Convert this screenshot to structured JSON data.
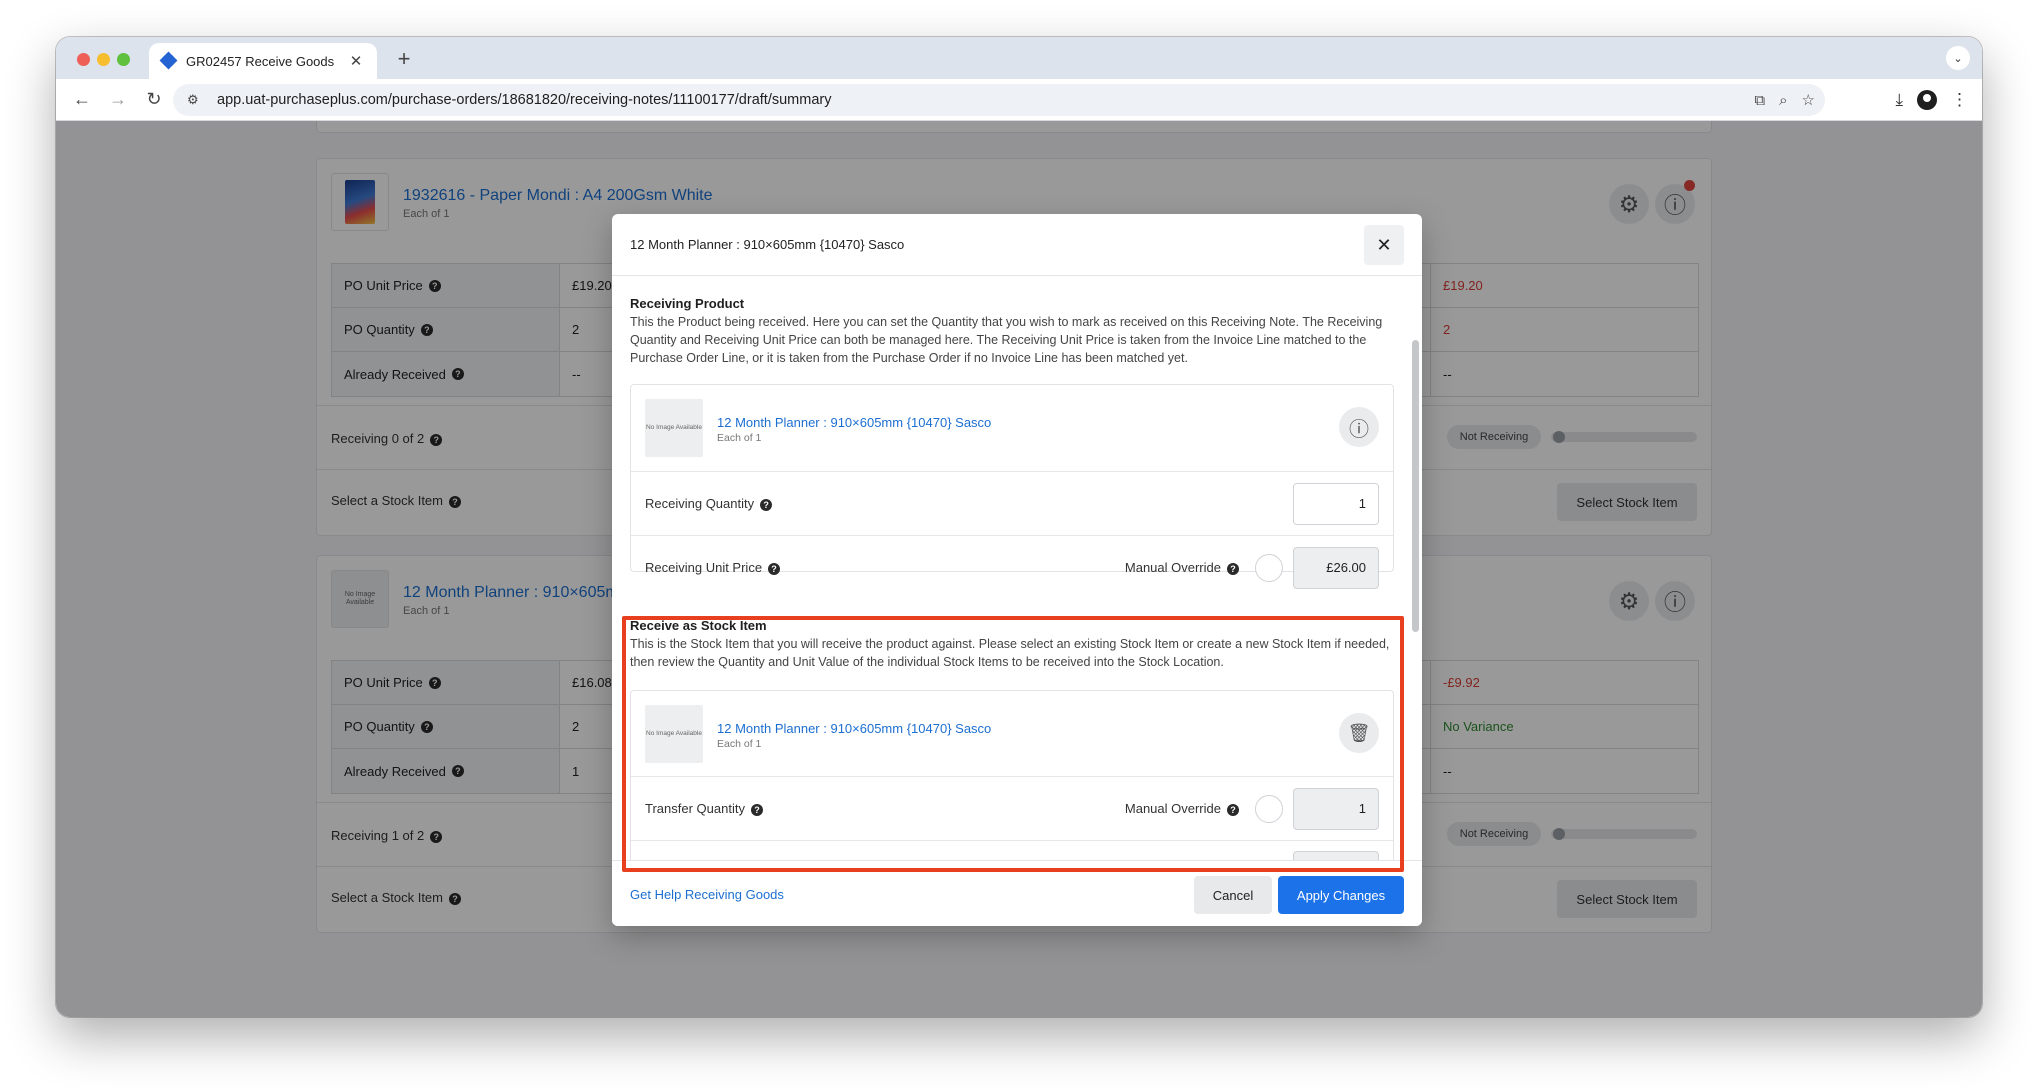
{
  "browser": {
    "tab_title": "GR02457 Receive Goods",
    "url": "app.uat-purchaseplus.com/purchase-orders/18681820/receiving-notes/11100177/draft/summary",
    "new_tab": "+",
    "icons": [
      "back-icon",
      "forward-icon",
      "reload-icon",
      "tune-icon",
      "install-icon",
      "zoom-icon",
      "star-icon",
      "download-icon",
      "avatar",
      "menu-icon"
    ]
  },
  "page": {
    "cards": [
      {
        "title": "1932616 - Paper Mondi : A4 200Gsm White",
        "subtitle": "Each of 1",
        "rows": [
          {
            "label": "PO Unit Price",
            "value": "£19.20",
            "right": "£19.20"
          },
          {
            "label": "PO Quantity",
            "value": "2",
            "right": "2"
          },
          {
            "label": "Already Received",
            "value": "--",
            "right": "--"
          }
        ],
        "receiving_label": "Receiving 0 of 2",
        "status": "Not Receiving",
        "select_label": "Select a Stock Item",
        "select_button": "Select Stock Item"
      },
      {
        "title": "12 Month Planner : 910×605mm {10470} Sasco",
        "subtitle": "Each of 1",
        "rows": [
          {
            "label": "PO Unit Price",
            "value": "£16.08",
            "right": "-£9.92"
          },
          {
            "label": "PO Quantity",
            "value": "2",
            "right": "No Variance"
          },
          {
            "label": "Already Received",
            "value": "1",
            "right": "--"
          }
        ],
        "receiving_label": "Receiving 1 of 2",
        "status": "Not Receiving",
        "select_label": "Select a Stock Item",
        "select_button": "Select Stock Item"
      }
    ]
  },
  "no_image_text": "No Image Available",
  "modal": {
    "title": "12 Month Planner : 910×605mm {10470} Sasco",
    "receiving_product": {
      "heading": "Receiving Product",
      "description": "This the Product being received. Here you can set the Quantity that you wish to mark as received on this Receiving Note. The Receiving Quantity and Receiving Unit Price can both be managed here. The Receiving Unit Price is taken from the Invoice Line matched to the Purchase Order Line, or it is taken from the Purchase Order if no Invoice Line has been matched yet.",
      "product_name": "12 Month Planner : 910×605mm {10470} Sasco",
      "product_sub": "Each of 1",
      "qty_label": "Receiving Quantity",
      "qty_value": "1",
      "price_label": "Receiving Unit Price",
      "manual_override": "Manual Override",
      "price_value": "£26.00"
    },
    "stock_item": {
      "heading": "Receive as Stock Item",
      "description": "This is the Stock Item that you will receive the product against. Please select an existing Stock Item or create a new Stock Item if needed, then review the Quantity and Unit Value of the individual Stock Items to be received into the Stock Location.",
      "item_name": "12 Month Planner : 910×605mm {10470} Sasco",
      "item_sub": "Each of 1",
      "transfer_label": "Transfer Quantity",
      "manual_override": "Manual Override",
      "transfer_value": "1"
    },
    "footer": {
      "help_link": "Get Help Receiving Goods",
      "cancel": "Cancel",
      "apply": "Apply Changes"
    }
  },
  "colors": {
    "link": "#1c6fd1",
    "primary_button": "#1c72e8",
    "highlight": "#e8401f",
    "negative": "#d93b33",
    "positive": "#2f8a2f"
  }
}
